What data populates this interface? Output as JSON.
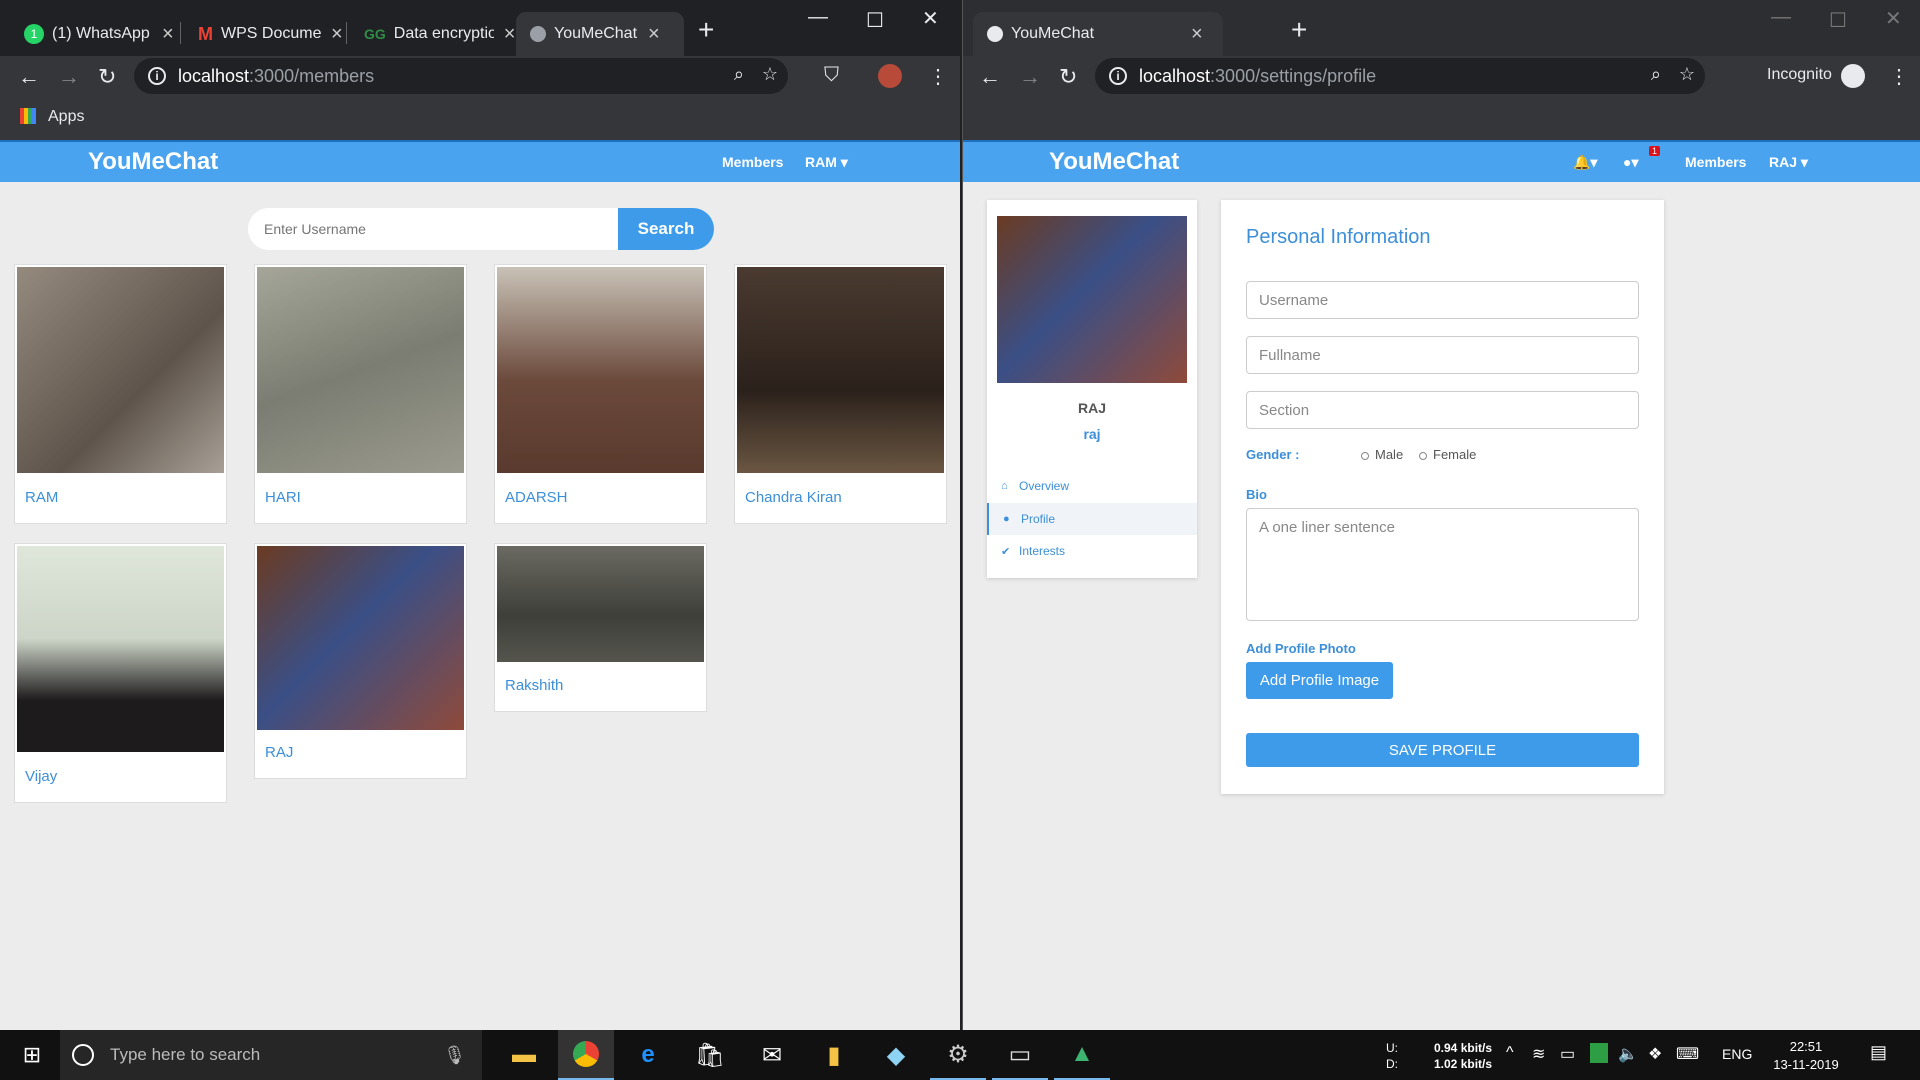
{
  "left_window": {
    "tabs": [
      {
        "title": "(1) WhatsApp",
        "icon": "whatsapp-icon",
        "badge": "1"
      },
      {
        "title": "WPS Documents",
        "icon": "gmail-icon"
      },
      {
        "title": "Data encryption",
        "icon": "gfg-icon"
      },
      {
        "title": "YouMeChat - ",
        "icon": "globe-icon"
      }
    ],
    "url_host": "localhost",
    "url_path": ":3000/members",
    "bookmarks_label": "Apps",
    "app": {
      "brand": "YouMeChat",
      "nav_members": "Members",
      "nav_user": "RAM",
      "search_placeholder": "Enter Username",
      "search_button": "Search",
      "members": [
        {
          "name": "RAM",
          "photo_color": "#7d7166"
        },
        {
          "name": "HARI",
          "photo_color": "#8a8a7e"
        },
        {
          "name": "ADARSH",
          "photo_color": "#6e5648"
        },
        {
          "name": "Chandra Kiran",
          "photo_color": "#3e2e26"
        },
        {
          "name": "Vijay",
          "photo_color": "#d4dccf"
        },
        {
          "name": "RAJ",
          "photo_color": "#3a4f86"
        },
        {
          "name": "Rakshith",
          "photo_color": "#4a4a44"
        }
      ]
    }
  },
  "right_window": {
    "tab_title": "YouMeChat",
    "url_host": "localhost",
    "url_path": ":3000/settings/profile",
    "incognito_label": "Incognito",
    "app": {
      "brand": "YouMeChat",
      "notif_badge": "1",
      "nav_members": "Members",
      "nav_user": "RAJ",
      "profile_name": "RAJ",
      "profile_username": "raj",
      "menu": [
        {
          "label": "Overview",
          "icon": "home-icon"
        },
        {
          "label": "Profile",
          "icon": "user-icon"
        },
        {
          "label": "Interests",
          "icon": "check-icon"
        }
      ],
      "form": {
        "heading": "Personal Information",
        "username_placeholder": "Username",
        "fullname_placeholder": "Fullname",
        "section_placeholder": "Section",
        "gender_label": "Gender :",
        "gender_male": "Male",
        "gender_female": "Female",
        "bio_label": "Bio",
        "bio_placeholder": "A one liner sentence",
        "photo_label": "Add Profile Photo",
        "photo_button": "Add Profile Image",
        "save_button": "SAVE PROFILE"
      }
    }
  },
  "taskbar": {
    "search_placeholder": "Type here to search",
    "net_up_label": "U:",
    "net_down_label": "D:",
    "net_up": "0.94 kbit/s",
    "net_down": "1.02 kbit/s",
    "lang": "ENG",
    "time": "22:51",
    "date": "13-11-2019"
  },
  "colors": {
    "accent": "#4aa3ef",
    "link": "#3c8fd8",
    "chrome_dark": "#202124"
  }
}
